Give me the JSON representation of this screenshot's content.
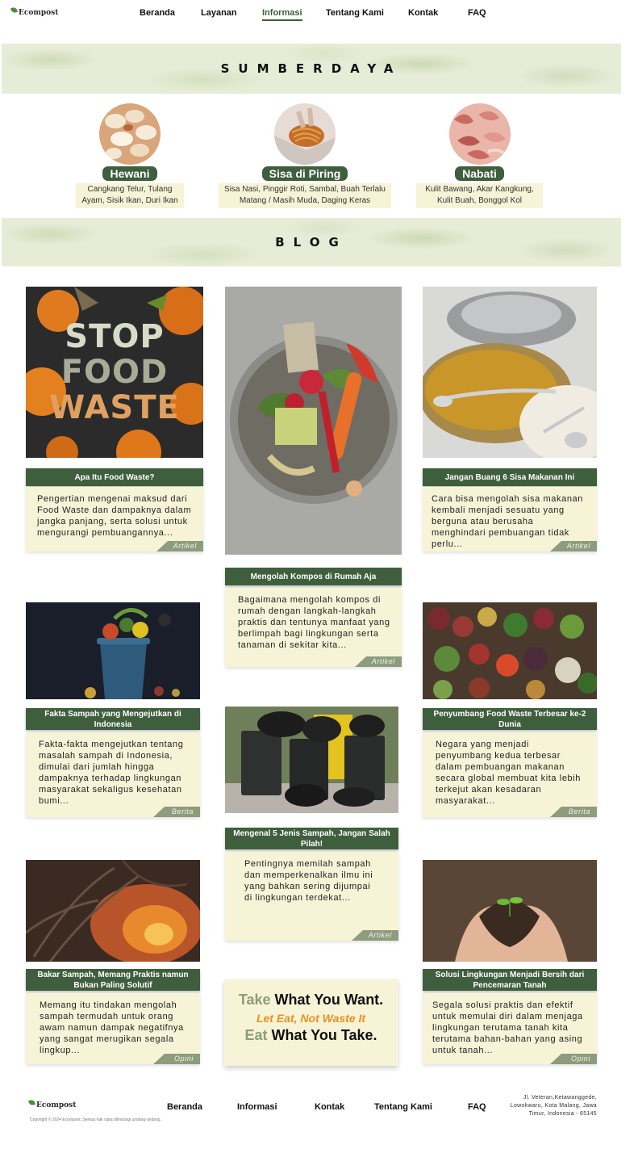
{
  "brand": {
    "logo_text": "Ecompost"
  },
  "nav": {
    "items": [
      "Beranda",
      "Layanan",
      "Informasi",
      "Tentang Kami",
      "Kontak",
      "FAQ"
    ],
    "active": "Informasi"
  },
  "sumberdaya": {
    "title": "SUMBERDAYA",
    "items": [
      {
        "label": "Hewani",
        "desc": "Cangkang Telur, Tulang Ayam, Sisik Ikan, Duri Ikan"
      },
      {
        "label": "Sisa di Piring",
        "desc": "Sisa Nasi, Pinggir Roti, Sambal, Buah Terlalu Matang / Masih Muda, Daging Keras"
      },
      {
        "label": "Nabati",
        "desc": "Kulit Bawang, Akar Kangkung, Kulit Buah, Bonggol Kol"
      }
    ]
  },
  "blog": {
    "title": "BLOG",
    "poster_text": [
      "STOP",
      "FOOD",
      "WASTE"
    ],
    "cards": [
      {
        "title": "Apa Itu Food Waste?",
        "excerpt": "Pengertian mengenai maksud dari Food Waste dan dampaknya dalam jangka panjang, serta solusi untuk mengurangi pembuangannya...",
        "tag": "Artikel"
      },
      {
        "title": "Mengolah Kompos di Rumah Aja",
        "excerpt": "Bagaimana mengolah kompos di rumah dengan langkah-langkah praktis dan tentunya manfaat yang berlimpah bagi lingkungan serta tanaman di sekitar kita...",
        "tag": "Artikel"
      },
      {
        "title": "Jangan Buang 6 Sisa Makanan Ini",
        "excerpt": "Cara bisa mengolah sisa makanan kembali menjadi sesuatu yang berguna atau berusaha menghindari pembuangan tidak perlu...",
        "tag": "Artikel"
      },
      {
        "title": "Fakta Sampah yang Mengejutkan di Indonesia",
        "excerpt": "Fakta-fakta mengejutkan tentang masalah sampah di Indonesia, dimulai dari jumlah hingga dampaknya terhadap lingkungan masyarakat sekaligus kesehatan bumi...",
        "tag": "Berita"
      },
      {
        "title": "Mengenal 5 Jenis Sampah, Jangan Salah Pilah!",
        "excerpt": "Pentingnya memilah sampah dan memperkenalkan ilmu ini yang bahkan sering dijumpai di lingkungan terdekat...",
        "tag": "Artikel"
      },
      {
        "title": "Penyumbang Food Waste Terbesar ke-2 Dunia",
        "excerpt": "Negara yang menjadi penyumbang kedua terbesar dalam pembuangan makanan secara global membuat kita lebih terkejut akan kesadaran masyarakat...",
        "tag": "Berita"
      },
      {
        "title": "Bakar Sampah, Memang Praktis namun Bukan Paling Solutif",
        "excerpt": "Memang itu tindakan mengolah sampah termudah untuk orang awam namun dampak negatifnya yang sangat merugikan segala lingkup...",
        "tag": "Opini"
      },
      {
        "title": "Solusi Lingkungan Menjadi Bersih dari Pencemaran Tanah",
        "excerpt": "Segala solusi praktis dan efektif untuk memulai diri dalam menjaga lingkungan terutama tanah kita terutama bahan-bahan yang asing untuk tanah...",
        "tag": "Opini"
      }
    ]
  },
  "quote": {
    "line1_a": "Take",
    "line1_b": "What You Want.",
    "line2": "Let Eat, Not Waste It",
    "line3_a": "Eat",
    "line3_b": "What You Take."
  },
  "footer": {
    "nav": [
      "Beranda",
      "Informasi",
      "Kontak",
      "Tentang Kami",
      "FAQ"
    ],
    "copyright": "Copyright © 2024 Ecompost. Semua hak cipta dilindungi undang-undang.",
    "address": "Jl. Veteran,Ketawanggede, Lowokwaru, Kota Malang, Jawa Timur, Indonesia - 65145"
  },
  "colors": {
    "primary": "#3f5e3d",
    "cream": "#f7f3d7",
    "tag": "#8c9c7c",
    "accent": "#e8921e"
  }
}
